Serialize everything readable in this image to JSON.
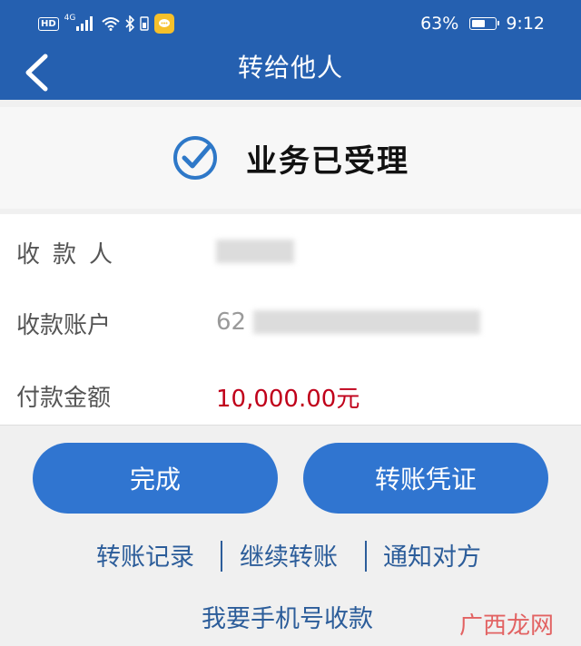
{
  "status_bar": {
    "hd_label": "HD",
    "network_label": "4G",
    "battery_percent": "63%",
    "battery_level": 0.63,
    "time": "9:12"
  },
  "header": {
    "title": "转给他人",
    "back_icon": "chevron-left-icon"
  },
  "result": {
    "icon": "check-circle-icon",
    "message": "业务已受理"
  },
  "details": {
    "payee_label": "收款人",
    "account_label": "收款账户",
    "account_prefix": "62",
    "amount_label": "付款金额",
    "amount_value": "10,000.00元"
  },
  "actions": {
    "done_label": "完成",
    "voucher_label": "转账凭证"
  },
  "links": {
    "history": "转账记录",
    "continue": "继续转账",
    "notify": "通知对方",
    "phone_collect": "我要手机号收款"
  },
  "watermark": "广西龙网",
  "colors": {
    "header_blue": "#2560b0",
    "button_blue": "#3075d0",
    "link_blue": "#2c5d9a",
    "amount_red": "#c0001a"
  }
}
